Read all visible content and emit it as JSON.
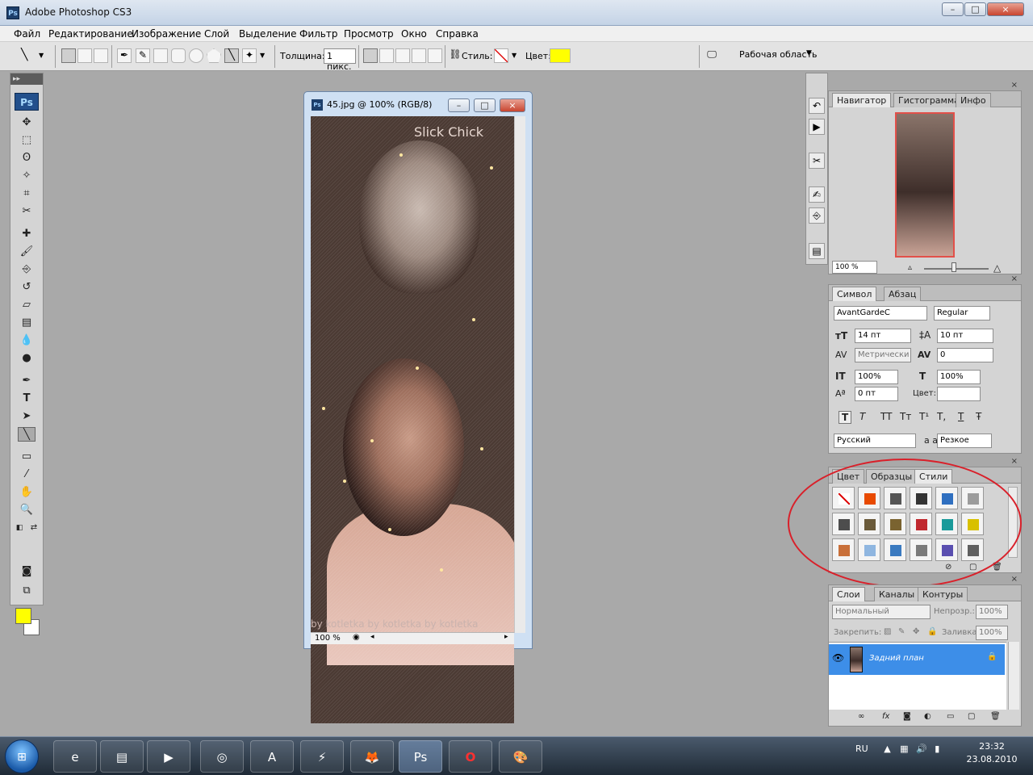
{
  "window": {
    "title": "Adobe Photoshop CS3",
    "min": "–",
    "max": "□",
    "close": "×"
  },
  "menu": [
    "Файл",
    "Редактирование",
    "Изображение",
    "Слой",
    "Выделение",
    "Фильтр",
    "Просмотр",
    "Окно",
    "Справка"
  ],
  "options": {
    "weight_label": "Толщина:",
    "weight_value": "1 пикс.",
    "style_label": "Стиль:",
    "color_label": "Цвет:",
    "color_value": "#ffff00",
    "workspace": "Рабочая область"
  },
  "toolbox": {
    "logo": "Ps",
    "collapse": "▸▸",
    "fg_color": "#ffff00",
    "bg_color": "#ffffff"
  },
  "document": {
    "title": "45.jpg @ 100% (RGB/8)",
    "zoom": "100 %",
    "watermark_top": "Slick Chick",
    "watermark_bottom": "by kotletka by kotletka by kotletka"
  },
  "navigator": {
    "tabs": [
      "Навигатор",
      "Гистограмма",
      "Инфо"
    ],
    "zoom": "100 %"
  },
  "character": {
    "tabs": [
      "Символ",
      "Абзац"
    ],
    "font_family": "AvantGardeC",
    "font_style": "Regular",
    "font_size": "14 пт",
    "leading": "10 пт",
    "kerning": "Метрически",
    "tracking": "0",
    "vscale": "100%",
    "hscale": "100%",
    "baseline": "0 пт",
    "color_label": "Цвет:",
    "language": "Русский",
    "antialias_label": "a a",
    "antialias": "Резкое",
    "styles_row": [
      "T",
      "T",
      "TT",
      "Tт",
      "T¹",
      "T,",
      "T",
      "Ŧ"
    ]
  },
  "styles_panel": {
    "tabs": [
      "Цвет",
      "Образцы",
      "Стили"
    ],
    "swatches": [
      "#ffffff",
      "#e84a00",
      "#555555",
      "#333333",
      "#2f6fc0",
      "#9c9c9c",
      "#4d4d4d",
      "#6a5a3a",
      "#7a6330",
      "#c0282e",
      "#1a9a9a",
      "#d8c000",
      "#c9703a",
      "#8fb6e0",
      "#3a7ac0",
      "#7a7a7a",
      "#5a4fb0",
      "#606060"
    ]
  },
  "layers": {
    "tabs": [
      "Слои",
      "Каналы",
      "Контуры"
    ],
    "blend_mode": "Нормальный",
    "opacity_label": "Непрозр.:",
    "opacity": "100%",
    "lock_label": "Закрепить:",
    "fill_label": "Заливка:",
    "fill": "100%",
    "layer_name": "Задний план"
  },
  "taskbar": {
    "start": "⊞",
    "lang": "RU",
    "time": "23:32",
    "date": "23.08.2010",
    "apps": [
      "e",
      "▤",
      "▶",
      "◎",
      "A",
      "⚡",
      "🦊",
      "Ps",
      "O",
      "🎨"
    ]
  }
}
